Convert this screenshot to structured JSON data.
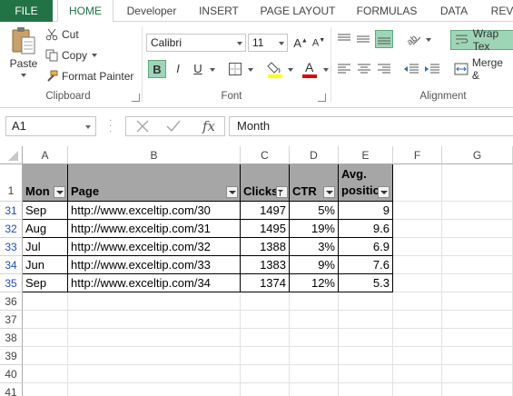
{
  "tabs": {
    "file": "FILE",
    "home": "HOME",
    "developer": "Developer",
    "insert": "INSERT",
    "page_layout": "PAGE LAYOUT",
    "formulas": "FORMULAS",
    "data": "DATA",
    "review": "REV"
  },
  "clipboard": {
    "paste": "Paste",
    "cut": "Cut",
    "copy": "Copy",
    "format_painter": "Format Painter",
    "label": "Clipboard"
  },
  "font": {
    "name": "Calibri",
    "size": "11",
    "bold": "B",
    "italic": "I",
    "underline": "U",
    "label": "Font",
    "font_color_accent": "#e00000",
    "fill_color_accent": "#ffff00"
  },
  "alignment": {
    "wrap_text": "Wrap Tex",
    "merge": "Merge &",
    "label": "Alignment"
  },
  "formula_bar": {
    "name_box": "A1",
    "formula": "Month",
    "fx": "fx"
  },
  "grid": {
    "columns": [
      "A",
      "B",
      "C",
      "D",
      "E",
      "F",
      "G"
    ],
    "header_row_number": "1",
    "headers": {
      "month": "Mon",
      "page": "Page",
      "clicks": "Clicks",
      "ctr": "CTR",
      "avg_line1": "Avg.",
      "avg_line2": "positic"
    },
    "rows": [
      {
        "num": "31",
        "month": "Sep",
        "page": "http://www.exceltip.com/30",
        "clicks": "1497",
        "ctr": "5%",
        "pos": "9"
      },
      {
        "num": "32",
        "month": "Aug",
        "page": "http://www.exceltip.com/31",
        "clicks": "1495",
        "ctr": "19%",
        "pos": "9.6"
      },
      {
        "num": "33",
        "month": "Jul",
        "page": "http://www.exceltip.com/32",
        "clicks": "1388",
        "ctr": "3%",
        "pos": "6.9"
      },
      {
        "num": "34",
        "month": "Jun",
        "page": "http://www.exceltip.com/33",
        "clicks": "1383",
        "ctr": "9%",
        "pos": "7.6"
      },
      {
        "num": "35",
        "month": "Sep",
        "page": "http://www.exceltip.com/34",
        "clicks": "1374",
        "ctr": "12%",
        "pos": "5.3"
      }
    ],
    "empty_rows": [
      "36",
      "37",
      "38",
      "39",
      "40",
      "41"
    ]
  },
  "colors": {
    "excel_green": "#217346",
    "header_fill": "#a6a6a6",
    "filtered_row_number": "#1f4dbd"
  }
}
